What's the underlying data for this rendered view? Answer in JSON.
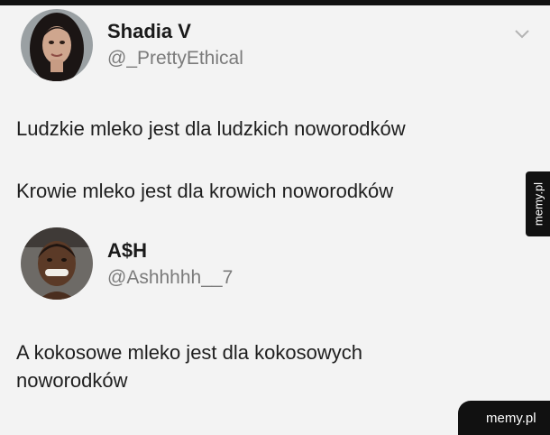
{
  "tweets": [
    {
      "display_name": "Shadia V",
      "handle": "@_PrettyEthical",
      "lines": [
        "Ludzkie mleko jest dla ludzkich noworodków",
        "Krowie mleko jest dla krowich noworodków"
      ]
    },
    {
      "display_name": "A$H",
      "handle": "@Ashhhhh__7",
      "lines": [
        "A kokosowe mleko jest dla kokosowych",
        "noworodków"
      ]
    }
  ],
  "watermarks": {
    "side": "memy.pl",
    "corner": "memy.pl"
  },
  "icons": {
    "menu_toggle": "chevron-down-icon"
  },
  "colors": {
    "background": "#f3f3f3",
    "text": "#1e1e1e",
    "handle": "#7b7b7b",
    "watermark_bg": "#111111"
  }
}
